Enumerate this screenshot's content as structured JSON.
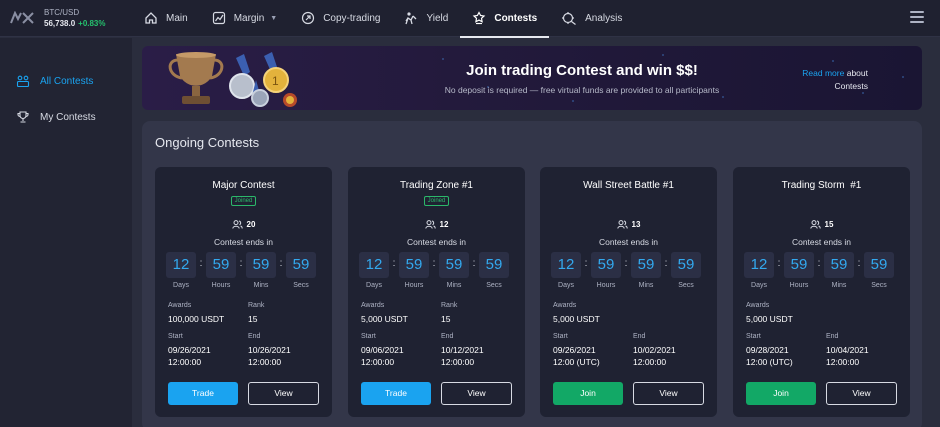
{
  "ticker": {
    "pair": "BTC/USD",
    "price": "56,738.0",
    "change": "+0.83%"
  },
  "nav": [
    {
      "label": "Main",
      "icon": "home-icon"
    },
    {
      "label": "Margin",
      "icon": "chart-icon"
    },
    {
      "label": "Copy-trading",
      "icon": "copy-icon"
    },
    {
      "label": "Yield",
      "icon": "yield-icon"
    },
    {
      "label": "Contests",
      "icon": "contest-icon",
      "active": true
    },
    {
      "label": "Analysis",
      "icon": "analysis-icon"
    }
  ],
  "sidebar": {
    "items": [
      {
        "label": "All Contests",
        "icon": "contests-list-icon",
        "active": true
      },
      {
        "label": "My Contests",
        "icon": "trophy-icon"
      }
    ]
  },
  "banner": {
    "title": "Join trading Contest and win $$!",
    "subtitle": "No deposit is required — free virtual funds are provided to all participants",
    "link_text": "Read more",
    "link_suffix": " about",
    "link_line2": "Contests"
  },
  "panel": {
    "title": "Ongoing Contests"
  },
  "timer_labels": {
    "days": "Days",
    "hours": "Hours",
    "mins": "Mins",
    "secs": "Secs"
  },
  "card_labels": {
    "ends": "Contest ends in",
    "awards": "Awards",
    "rank": "Rank",
    "start": "Start",
    "end": "End",
    "view": "View"
  },
  "contests": [
    {
      "title": "Major Contest",
      "badge": "Joined",
      "participants": "20",
      "timer": {
        "days": "12",
        "hours": "59",
        "mins": "59",
        "secs": "59"
      },
      "awards": "100,000 USDT",
      "rank": "15",
      "start_date": "09/26/2021",
      "start_time": "12:00:00",
      "end_date": "10/26/2021",
      "end_time": "12:00:00",
      "action": "Trade"
    },
    {
      "title": "Trading Zone #1",
      "badge": "Joined",
      "participants": "12",
      "timer": {
        "days": "12",
        "hours": "59",
        "mins": "59",
        "secs": "59"
      },
      "awards": "5,000 USDT",
      "rank": "15",
      "start_date": "09/06/2021",
      "start_time": "12:00:00",
      "end_date": "10/12/2021",
      "end_time": "12:00:00",
      "action": "Trade"
    },
    {
      "title": "Wall Street Battle #1",
      "badge": "",
      "participants": "13",
      "timer": {
        "days": "12",
        "hours": "59",
        "mins": "59",
        "secs": "59"
      },
      "awards": "5,000 USDT",
      "rank": "",
      "start_date": "09/26/2021",
      "start_time": "12:00 (UTC)",
      "end_date": "10/02/2021",
      "end_time": "12:00:00",
      "action": "Join"
    },
    {
      "title": "Trading Storm  #1",
      "badge": "",
      "participants": "15",
      "timer": {
        "days": "12",
        "hours": "59",
        "mins": "59",
        "secs": "59"
      },
      "awards": "5,000 USDT",
      "rank": "",
      "start_date": "09/28/2021",
      "start_time": "12:00 (UTC)",
      "end_date": "10/04/2021",
      "end_time": "12:00:00",
      "action": "Join"
    }
  ],
  "colors": {
    "accent": "#1aa3f0",
    "join": "#12a866",
    "positive": "#25c26e",
    "timer_digits": "#33a9ef"
  }
}
